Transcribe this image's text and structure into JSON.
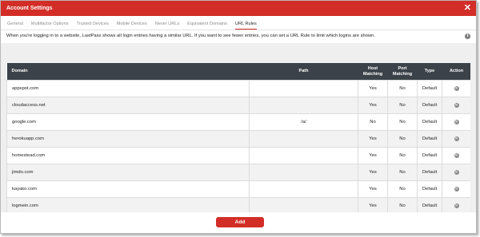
{
  "window": {
    "title": "Account Settings",
    "close_icon": "close-icon"
  },
  "tabs": [
    {
      "label": "General"
    },
    {
      "label": "Multifactor Options"
    },
    {
      "label": "Trusted Devices"
    },
    {
      "label": "Mobile Devices"
    },
    {
      "label": "Never URLs"
    },
    {
      "label": "Equivalent Domains"
    },
    {
      "label": "URL Rules"
    }
  ],
  "active_tab": "URL Rules",
  "description": "When you're logging in to a website, LastPass shows all login entries having a similar URL. If you want to see fewer entries, you can set a URL Rule to limit which logins are shown.",
  "info_icon": "i",
  "table": {
    "headers": {
      "domain": "Domain",
      "path": "Path",
      "host_matching": "Host Matching",
      "port_matching": "Port Matching",
      "type": "Type",
      "action": "Action"
    },
    "rows": [
      {
        "domain": "appspot.com",
        "path": "",
        "host": "Yes",
        "port": "No",
        "type": "Default"
      },
      {
        "domain": "cloudaccess.net",
        "path": "",
        "host": "Yes",
        "port": "No",
        "type": "Default"
      },
      {
        "domain": "google.com",
        "path": "/a/",
        "host": "No",
        "port": "No",
        "type": "Default"
      },
      {
        "domain": "herokuapp.com",
        "path": "",
        "host": "Yes",
        "port": "No",
        "type": "Default"
      },
      {
        "domain": "homestead.com",
        "path": "",
        "host": "Yes",
        "port": "No",
        "type": "Default"
      },
      {
        "domain": "jimdo.com",
        "path": "",
        "host": "Yes",
        "port": "No",
        "type": "Default"
      },
      {
        "domain": "kayako.com",
        "path": "",
        "host": "Yes",
        "port": "No",
        "type": "Default"
      },
      {
        "domain": "logmein.com",
        "path": "",
        "host": "Yes",
        "port": "No",
        "type": "Default"
      }
    ]
  },
  "add_button": "Add",
  "colors": {
    "accent": "#d32d27",
    "header_bg": "#3b4249"
  }
}
